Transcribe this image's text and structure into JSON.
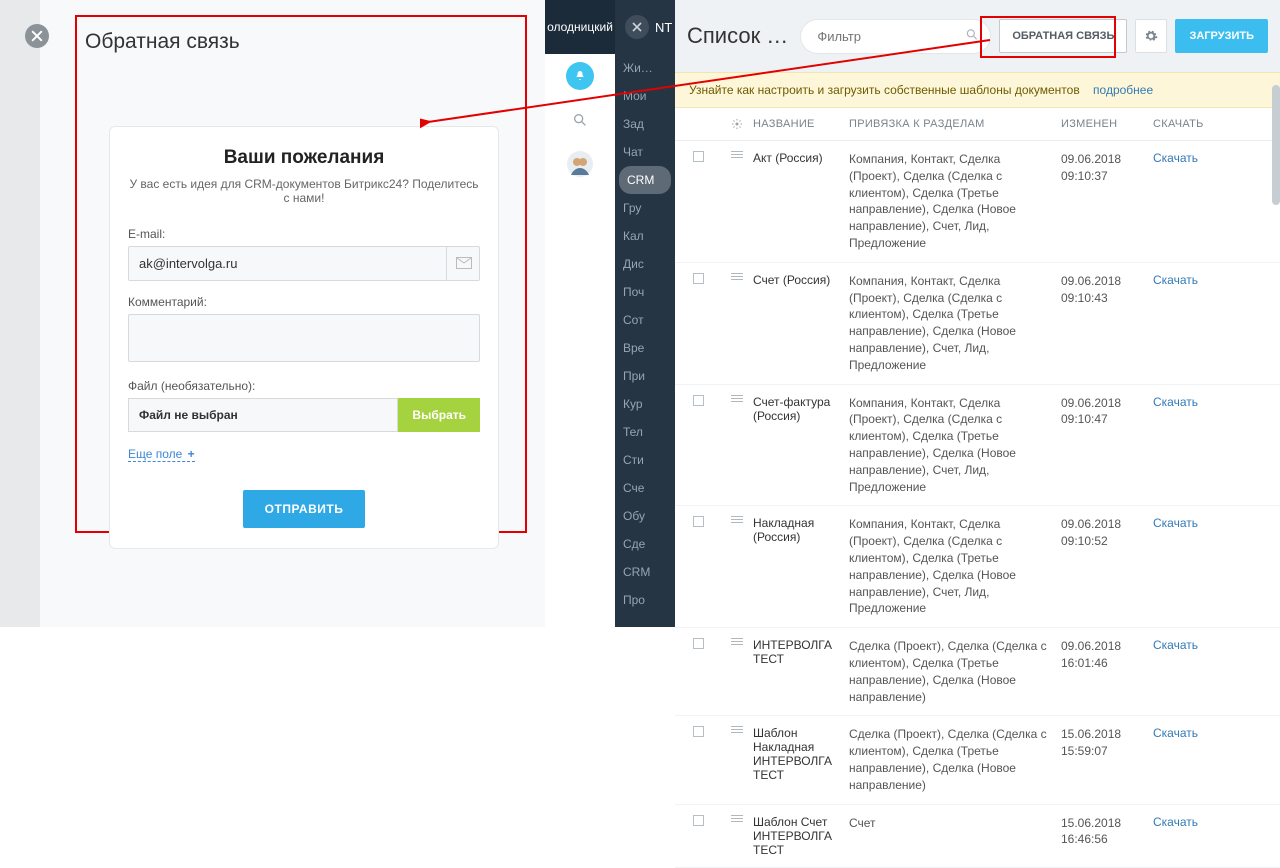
{
  "left": {
    "title": "Обратная связь",
    "form": {
      "headline": "Ваши пожелания",
      "sub": "У вас есть идея для CRM-документов Битрикс24? Поделитесь с нами!",
      "email_label": "E-mail:",
      "email_value": "ak@intervolga.ru",
      "comment_label": "Комментарий:",
      "file_label": "Файл (необязательно):",
      "file_value": "Файл не выбран",
      "file_button": "Выбрать",
      "more_fields": "Еще поле",
      "send": "ОТПРАВИТЬ"
    },
    "rightbar_top": "олодницкий"
  },
  "right": {
    "nav": [
      "Жи…",
      "Мои",
      "Зад",
      "Чат",
      "CRM",
      "Гру",
      "Кал",
      "Дис",
      "Поч",
      "Сот",
      "Вре",
      "При",
      "Кур",
      "Тел",
      "Сти",
      "Сче",
      "Обу",
      "Сде",
      "CRM",
      "Про"
    ],
    "list_title": "Список …",
    "filter_placeholder": "Фильтр",
    "btn_feedback": "ОБРАТНАЯ СВЯЗЬ",
    "btn_upload": "ЗАГРУЗИТЬ",
    "banner_text": "Узнайте как настроить и загрузить собственные шаблоны документов",
    "banner_link": "подробнее",
    "th": {
      "name": "НАЗВАНИЕ",
      "bind": "ПРИВЯЗКА К РАЗДЕЛАМ",
      "date": "ИЗМЕНЕН",
      "dl": "СКАЧАТЬ"
    },
    "dl_label": "Скачать",
    "rows": [
      {
        "name": "Акт (Россия)",
        "bind": "Компания, Контакт, Сделка (Проект), Сделка (Сделка с клиентом), Сделка (Третье направление), Сделка (Новое направление), Счет, Лид, Предложение",
        "date": "09.06.2018 09:10:37"
      },
      {
        "name": "Счет (Россия)",
        "bind": "Компания, Контакт, Сделка (Проект), Сделка (Сделка с клиентом), Сделка (Третье направление), Сделка (Новое направление), Счет, Лид, Предложение",
        "date": "09.06.2018 09:10:43"
      },
      {
        "name": "Счет-фактура (Россия)",
        "bind": "Компания, Контакт, Сделка (Проект), Сделка (Сделка с клиентом), Сделка (Третье направление), Сделка (Новое направление), Счет, Лид, Предложение",
        "date": "09.06.2018 09:10:47"
      },
      {
        "name": "Накладная (Россия)",
        "bind": "Компания, Контакт, Сделка (Проект), Сделка (Сделка с клиентом), Сделка (Третье направление), Сделка (Новое направление), Счет, Лид, Предложение",
        "date": "09.06.2018 09:10:52"
      },
      {
        "name": "ИНТЕРВОЛГА ТЕСТ",
        "bind": "Сделка (Проект), Сделка (Сделка с клиентом), Сделка (Третье направление), Сделка (Новое направление)",
        "date": "09.06.2018 16:01:46"
      },
      {
        "name": "Шаблон Накладная ИНТЕРВОЛГА ТЕСТ",
        "bind": "Сделка (Проект), Сделка (Сделка с клиентом), Сделка (Третье направление), Сделка (Новое направление)",
        "date": "15.06.2018 15:59:07"
      },
      {
        "name": "Шаблон Счет ИНТЕРВОЛГА ТЕСТ",
        "bind": "Счет",
        "date": "15.06.2018 16:46:56"
      }
    ]
  }
}
